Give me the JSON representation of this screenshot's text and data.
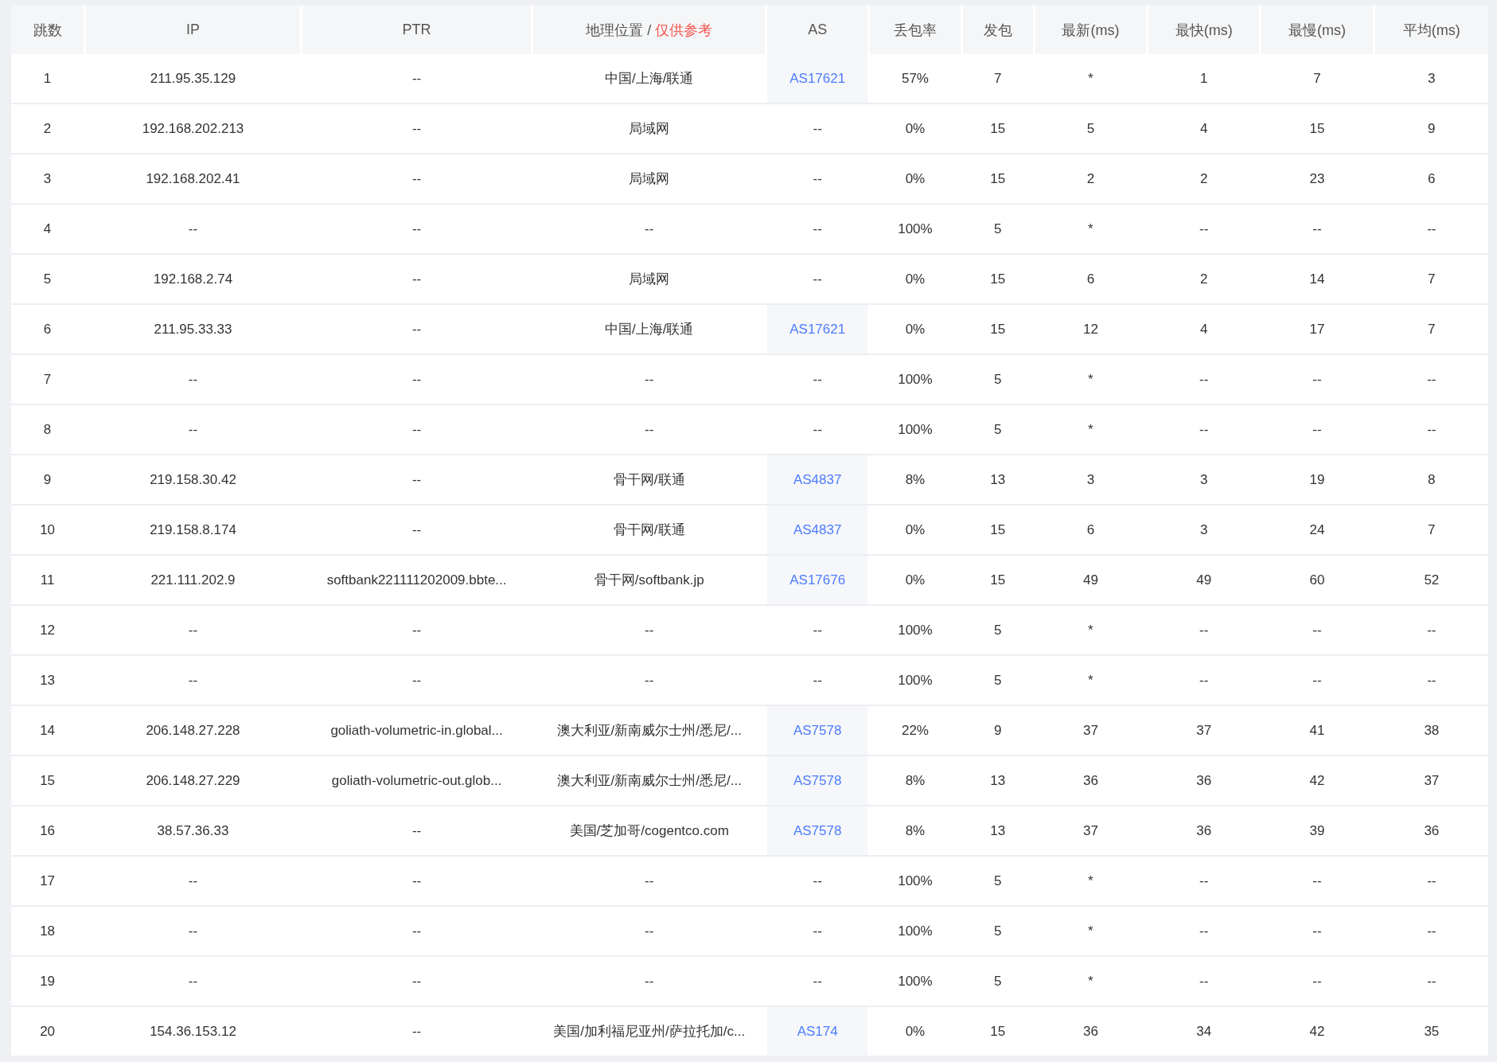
{
  "table": {
    "columns": [
      {
        "label": "跳数"
      },
      {
        "label": "IP"
      },
      {
        "label": "PTR"
      },
      {
        "label": "地理位置 /",
        "note": "仅供参考"
      },
      {
        "label": "AS"
      },
      {
        "label": "丢包率"
      },
      {
        "label": "发包"
      },
      {
        "label": "最新(ms)"
      },
      {
        "label": "最快(ms)"
      },
      {
        "label": "最慢(ms)"
      },
      {
        "label": "平均(ms)"
      }
    ],
    "rows": [
      {
        "hop": "1",
        "ip": "211.95.35.129",
        "ptr": "--",
        "geo": "中国/上海/联通",
        "as": "AS17621",
        "as_linked": true,
        "loss": "57%",
        "sent": "7",
        "last": "*",
        "best": "1",
        "worst": "7",
        "avg": "3"
      },
      {
        "hop": "2",
        "ip": "192.168.202.213",
        "ptr": "--",
        "geo": "局域网",
        "as": "--",
        "as_linked": false,
        "loss": "0%",
        "sent": "15",
        "last": "5",
        "best": "4",
        "worst": "15",
        "avg": "9"
      },
      {
        "hop": "3",
        "ip": "192.168.202.41",
        "ptr": "--",
        "geo": "局域网",
        "as": "--",
        "as_linked": false,
        "loss": "0%",
        "sent": "15",
        "last": "2",
        "best": "2",
        "worst": "23",
        "avg": "6"
      },
      {
        "hop": "4",
        "ip": "--",
        "ptr": "--",
        "geo": "--",
        "as": "--",
        "as_linked": false,
        "loss": "100%",
        "sent": "5",
        "last": "*",
        "best": "--",
        "worst": "--",
        "avg": "--"
      },
      {
        "hop": "5",
        "ip": "192.168.2.74",
        "ptr": "--",
        "geo": "局域网",
        "as": "--",
        "as_linked": false,
        "loss": "0%",
        "sent": "15",
        "last": "6",
        "best": "2",
        "worst": "14",
        "avg": "7"
      },
      {
        "hop": "6",
        "ip": "211.95.33.33",
        "ptr": "--",
        "geo": "中国/上海/联通",
        "as": "AS17621",
        "as_linked": true,
        "loss": "0%",
        "sent": "15",
        "last": "12",
        "best": "4",
        "worst": "17",
        "avg": "7"
      },
      {
        "hop": "7",
        "ip": "--",
        "ptr": "--",
        "geo": "--",
        "as": "--",
        "as_linked": false,
        "loss": "100%",
        "sent": "5",
        "last": "*",
        "best": "--",
        "worst": "--",
        "avg": "--"
      },
      {
        "hop": "8",
        "ip": "--",
        "ptr": "--",
        "geo": "--",
        "as": "--",
        "as_linked": false,
        "loss": "100%",
        "sent": "5",
        "last": "*",
        "best": "--",
        "worst": "--",
        "avg": "--"
      },
      {
        "hop": "9",
        "ip": "219.158.30.42",
        "ptr": "--",
        "geo": "骨干网/联通",
        "as": "AS4837",
        "as_linked": true,
        "loss": "8%",
        "sent": "13",
        "last": "3",
        "best": "3",
        "worst": "19",
        "avg": "8"
      },
      {
        "hop": "10",
        "ip": "219.158.8.174",
        "ptr": "--",
        "geo": "骨干网/联通",
        "as": "AS4837",
        "as_linked": true,
        "loss": "0%",
        "sent": "15",
        "last": "6",
        "best": "3",
        "worst": "24",
        "avg": "7"
      },
      {
        "hop": "11",
        "ip": "221.111.202.9",
        "ptr": "softbank221111202009.bbte...",
        "geo": "骨干网/softbank.jp",
        "as": "AS17676",
        "as_linked": true,
        "loss": "0%",
        "sent": "15",
        "last": "49",
        "best": "49",
        "worst": "60",
        "avg": "52"
      },
      {
        "hop": "12",
        "ip": "--",
        "ptr": "--",
        "geo": "--",
        "as": "--",
        "as_linked": false,
        "loss": "100%",
        "sent": "5",
        "last": "*",
        "best": "--",
        "worst": "--",
        "avg": "--"
      },
      {
        "hop": "13",
        "ip": "--",
        "ptr": "--",
        "geo": "--",
        "as": "--",
        "as_linked": false,
        "loss": "100%",
        "sent": "5",
        "last": "*",
        "best": "--",
        "worst": "--",
        "avg": "--"
      },
      {
        "hop": "14",
        "ip": "206.148.27.228",
        "ptr": "goliath-volumetric-in.global...",
        "geo": "澳大利亚/新南威尔士州/悉尼/...",
        "as": "AS7578",
        "as_linked": true,
        "loss": "22%",
        "sent": "9",
        "last": "37",
        "best": "37",
        "worst": "41",
        "avg": "38"
      },
      {
        "hop": "15",
        "ip": "206.148.27.229",
        "ptr": "goliath-volumetric-out.glob...",
        "geo": "澳大利亚/新南威尔士州/悉尼/...",
        "as": "AS7578",
        "as_linked": true,
        "loss": "8%",
        "sent": "13",
        "last": "36",
        "best": "36",
        "worst": "42",
        "avg": "37"
      },
      {
        "hop": "16",
        "ip": "38.57.36.33",
        "ptr": "--",
        "geo": "美国/芝加哥/cogentco.com",
        "as": "AS7578",
        "as_linked": true,
        "loss": "8%",
        "sent": "13",
        "last": "37",
        "best": "36",
        "worst": "39",
        "avg": "36"
      },
      {
        "hop": "17",
        "ip": "--",
        "ptr": "--",
        "geo": "--",
        "as": "--",
        "as_linked": false,
        "loss": "100%",
        "sent": "5",
        "last": "*",
        "best": "--",
        "worst": "--",
        "avg": "--"
      },
      {
        "hop": "18",
        "ip": "--",
        "ptr": "--",
        "geo": "--",
        "as": "--",
        "as_linked": false,
        "loss": "100%",
        "sent": "5",
        "last": "*",
        "best": "--",
        "worst": "--",
        "avg": "--"
      },
      {
        "hop": "19",
        "ip": "--",
        "ptr": "--",
        "geo": "--",
        "as": "--",
        "as_linked": false,
        "loss": "100%",
        "sent": "5",
        "last": "*",
        "best": "--",
        "worst": "--",
        "avg": "--"
      },
      {
        "hop": "20",
        "ip": "154.36.153.12",
        "ptr": "--",
        "geo": "美国/加利福尼亚州/萨拉托加/c...",
        "as": "AS174",
        "as_linked": true,
        "loss": "0%",
        "sent": "15",
        "last": "36",
        "best": "34",
        "worst": "42",
        "avg": "35"
      }
    ]
  }
}
